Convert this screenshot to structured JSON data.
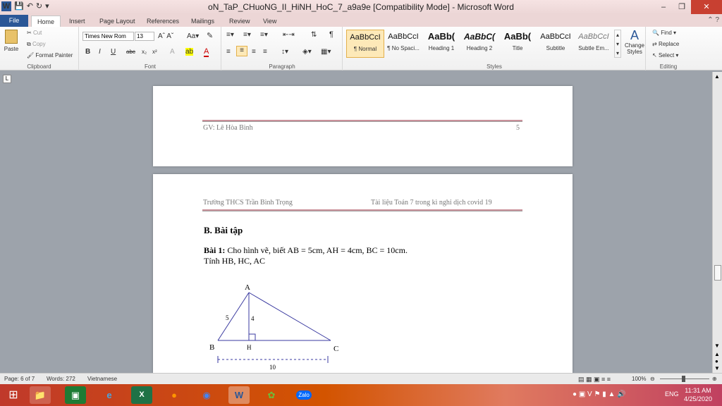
{
  "window": {
    "title": "oN_TaP_CHuoNG_II_HiNH_HoC_7_a9a9e [Compatibility Mode]  -  Microsoft Word"
  },
  "tabs": [
    "File",
    "Home",
    "Insert",
    "Page Layout",
    "References",
    "Mailings",
    "Review",
    "View"
  ],
  "clipboard": {
    "paste": "Paste",
    "cut": "Cut",
    "copy": "Copy",
    "format_painter": "Format Painter",
    "label": "Clipboard"
  },
  "font": {
    "family": "Times New Rom",
    "size": "13",
    "label": "Font"
  },
  "paragraph": {
    "label": "Paragraph"
  },
  "styles": {
    "label": "Styles",
    "items": [
      {
        "preview": "AaBbCcI",
        "name": "¶ Normal"
      },
      {
        "preview": "AaBbCcI",
        "name": "¶ No Spaci..."
      },
      {
        "preview": "AaBb(",
        "name": "Heading 1"
      },
      {
        "preview": "AaBbC(",
        "name": "Heading 2"
      },
      {
        "preview": "AaBb(",
        "name": "Title"
      },
      {
        "preview": "AaBbCcI",
        "name": "Subtitle"
      },
      {
        "preview": "AaBbCcI",
        "name": "Subtle Em..."
      }
    ],
    "change_styles": "Change Styles"
  },
  "editing": {
    "find": "Find",
    "replace": "Replace",
    "select": "Select",
    "label": "Editing"
  },
  "page5": {
    "footer_left": "GV: Lê Hòa Bình",
    "footer_right": "5"
  },
  "page6": {
    "header_left": "Trường THCS Trần Bình Trọng",
    "header_right": "Tài liệu Toán 7 trong kì nghỉ dịch covid 19",
    "section_title": "B. Bài tập",
    "exercise_label": "Bài 1:",
    "exercise_text": " Cho hình vẽ, biết AB = 5cm, AH = 4cm, BC = 10cm.",
    "exercise_line2": "Tính HB, HC, AC",
    "figure": {
      "A": "A",
      "B": "B",
      "C": "C",
      "H": "H",
      "ab": "5",
      "ah": "4",
      "bc": "10"
    }
  },
  "status": {
    "page": "Page: 6 of 7",
    "words": "Words: 272",
    "lang": "Vietnamese",
    "zoom": "100%"
  },
  "taskbar": {
    "lang": "ENG",
    "time": "11:31 AM",
    "date": "4/25/2020",
    "zalo": "Zalo"
  }
}
